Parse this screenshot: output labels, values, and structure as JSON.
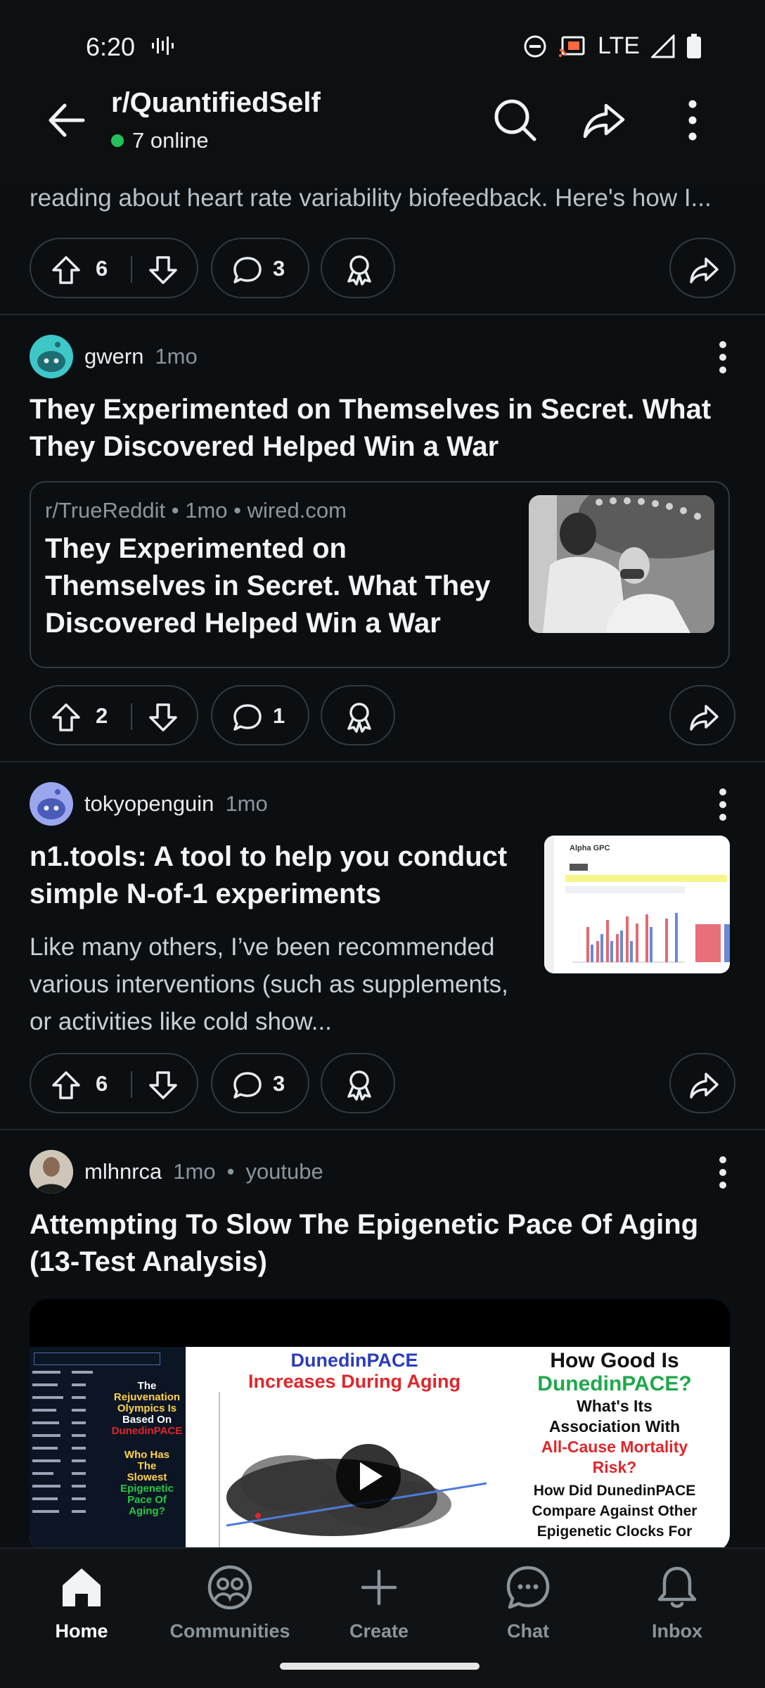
{
  "status": {
    "time": "6:20",
    "network": "LTE"
  },
  "header": {
    "subreddit": "r/QuantifiedSelf",
    "online": "7 online"
  },
  "post0": {
    "snippet": "reading about heart rate variability biofeedback. Here's how I...",
    "upvotes": "6",
    "comments": "3"
  },
  "post1": {
    "author": "gwern",
    "age": "1mo",
    "title": "They Experimented on Themselves in Secret. What They Discovered Helped Win a War",
    "link_sub": "r/TrueReddit",
    "link_age": "1mo",
    "link_domain": "wired.com",
    "link_title": "They Experimented on Themselves in Secret. What They Discovered Helped Win a War",
    "upvotes": "2",
    "comments": "1"
  },
  "post2": {
    "author": "tokyopenguin",
    "age": "1mo",
    "title": "n1.tools: A tool to help you conduct simple N-of-1 experiments",
    "body": "Like many others, I’ve been recommended various interventions (such as supplements, or activities like cold show...",
    "thumb_title": "Alpha GPC",
    "upvotes": "6",
    "comments": "3"
  },
  "post3": {
    "author": "mlhnrca",
    "age": "1mo",
    "source": "youtube",
    "title": "Attempting To Slow The Epigenetic Pace Of Aging (13-Test Analysis)",
    "video_mid_title_1": "DunedinPACE",
    "video_mid_title_2": "Increases During Aging",
    "video_right_1": "How Good Is",
    "video_right_2": "DunedinPACE?",
    "video_right_3": "What's Its",
    "video_right_4": "Association With",
    "video_right_5": "All-Cause Mortality",
    "video_right_6": "Risk?",
    "video_right_7": "How Did DunedinPACE",
    "video_right_8": "Compare Against Other",
    "video_right_9": "Epigenetic Clocks For",
    "video_left_1": "The",
    "video_left_2": "Rejuvenation",
    "video_left_3": "Olympics Is",
    "video_left_4": "Based On",
    "video_left_5": "DunedinPACE",
    "video_left_6": "Who Has",
    "video_left_7": "The",
    "video_left_8": "Slowest",
    "video_left_9": "Epigenetic",
    "video_left_10": "Pace Of",
    "video_left_11": "Aging?"
  },
  "nav": {
    "home": "Home",
    "communities": "Communities",
    "create": "Create",
    "chat": "Chat",
    "inbox": "Inbox"
  },
  "colors": {
    "online_dot": "#25c05a",
    "background": "#0b0f12",
    "accent_blue": "#2a3db8",
    "accent_red": "#e0262b"
  }
}
